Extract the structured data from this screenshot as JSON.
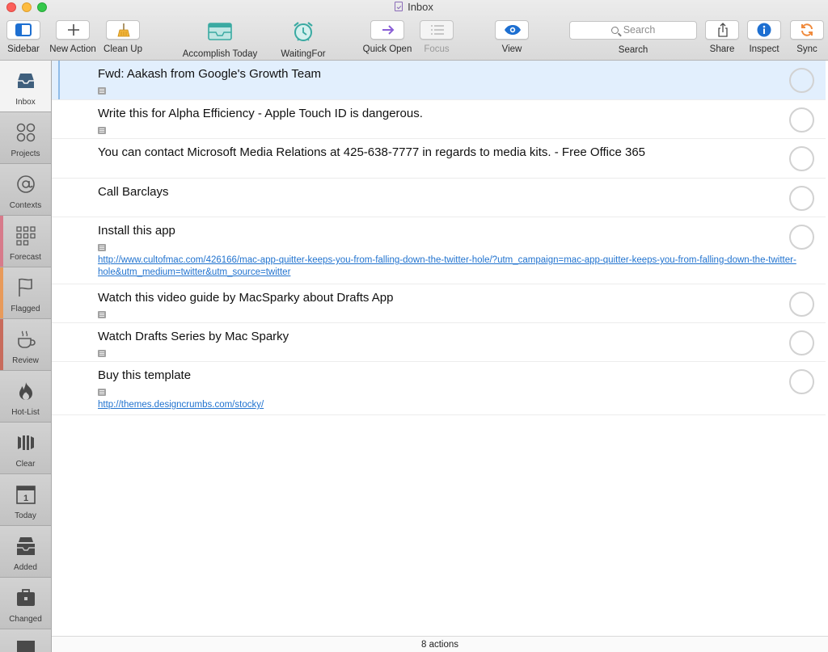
{
  "window": {
    "title": "Inbox"
  },
  "toolbar": {
    "sidebar": "Sidebar",
    "new_action": "New Action",
    "clean_up": "Clean Up",
    "accomplish_today": "Accomplish Today",
    "waiting_for": "WaitingFor",
    "quick_open": "Quick Open",
    "focus": "Focus",
    "view": "View",
    "search_placeholder": "Search",
    "search_label": "Search",
    "share": "Share",
    "inspect": "Inspect",
    "sync": "Sync"
  },
  "sidebar": {
    "items": [
      {
        "label": "Inbox",
        "icon": "inbox-tray-icon"
      },
      {
        "label": "Projects",
        "icon": "projects-icon"
      },
      {
        "label": "Contexts",
        "icon": "at-sign-icon"
      },
      {
        "label": "Forecast",
        "icon": "calendar-grid-icon"
      },
      {
        "label": "Flagged",
        "icon": "flag-icon"
      },
      {
        "label": "Review",
        "icon": "coffee-cup-icon"
      },
      {
        "label": "Hot-List",
        "icon": "flame-icon"
      },
      {
        "label": "Clear",
        "icon": "clear-icon"
      },
      {
        "label": "Today",
        "icon": "calendar-day-icon"
      },
      {
        "label": "Added",
        "icon": "tray-stack-icon"
      },
      {
        "label": "Changed",
        "icon": "briefcase-icon"
      }
    ]
  },
  "actions": [
    {
      "title": "Fwd: Aakash from Google's Growth Team",
      "has_note": true,
      "link": ""
    },
    {
      "title": "Write this for Alpha Efficiency - Apple Touch ID is dangerous.",
      "has_note": true,
      "link": ""
    },
    {
      "title": "You can contact Microsoft Media Relations at 425-638-7777 in regards to media kits. - Free Office 365",
      "has_note": false,
      "link": ""
    },
    {
      "title": "Call Barclays",
      "has_note": false,
      "link": ""
    },
    {
      "title": "Install this app",
      "has_note": true,
      "link": "http://www.cultofmac.com/426166/mac-app-quitter-keeps-you-from-falling-down-the-twitter-hole/?utm_campaign=mac-app-quitter-keeps-you-from-falling-down-the-twitter-hole&utm_medium=twitter&utm_source=twitter"
    },
    {
      "title": "Watch this video guide by MacSparky about Drafts App",
      "has_note": true,
      "link": ""
    },
    {
      "title": "Watch Drafts Series by Mac Sparky",
      "has_note": true,
      "link": ""
    },
    {
      "title": "Buy this template",
      "has_note": true,
      "link": "http://themes.designcrumbs.com/stocky/"
    }
  ],
  "status": {
    "text": "8 actions"
  },
  "colors": {
    "selection": "#e2effd",
    "link": "#2173cf",
    "accent_purple": "#8a5fd6",
    "accent_teal": "#3aaaa2",
    "accent_orange": "#f08a3c",
    "accent_blue": "#1d6fd1"
  }
}
